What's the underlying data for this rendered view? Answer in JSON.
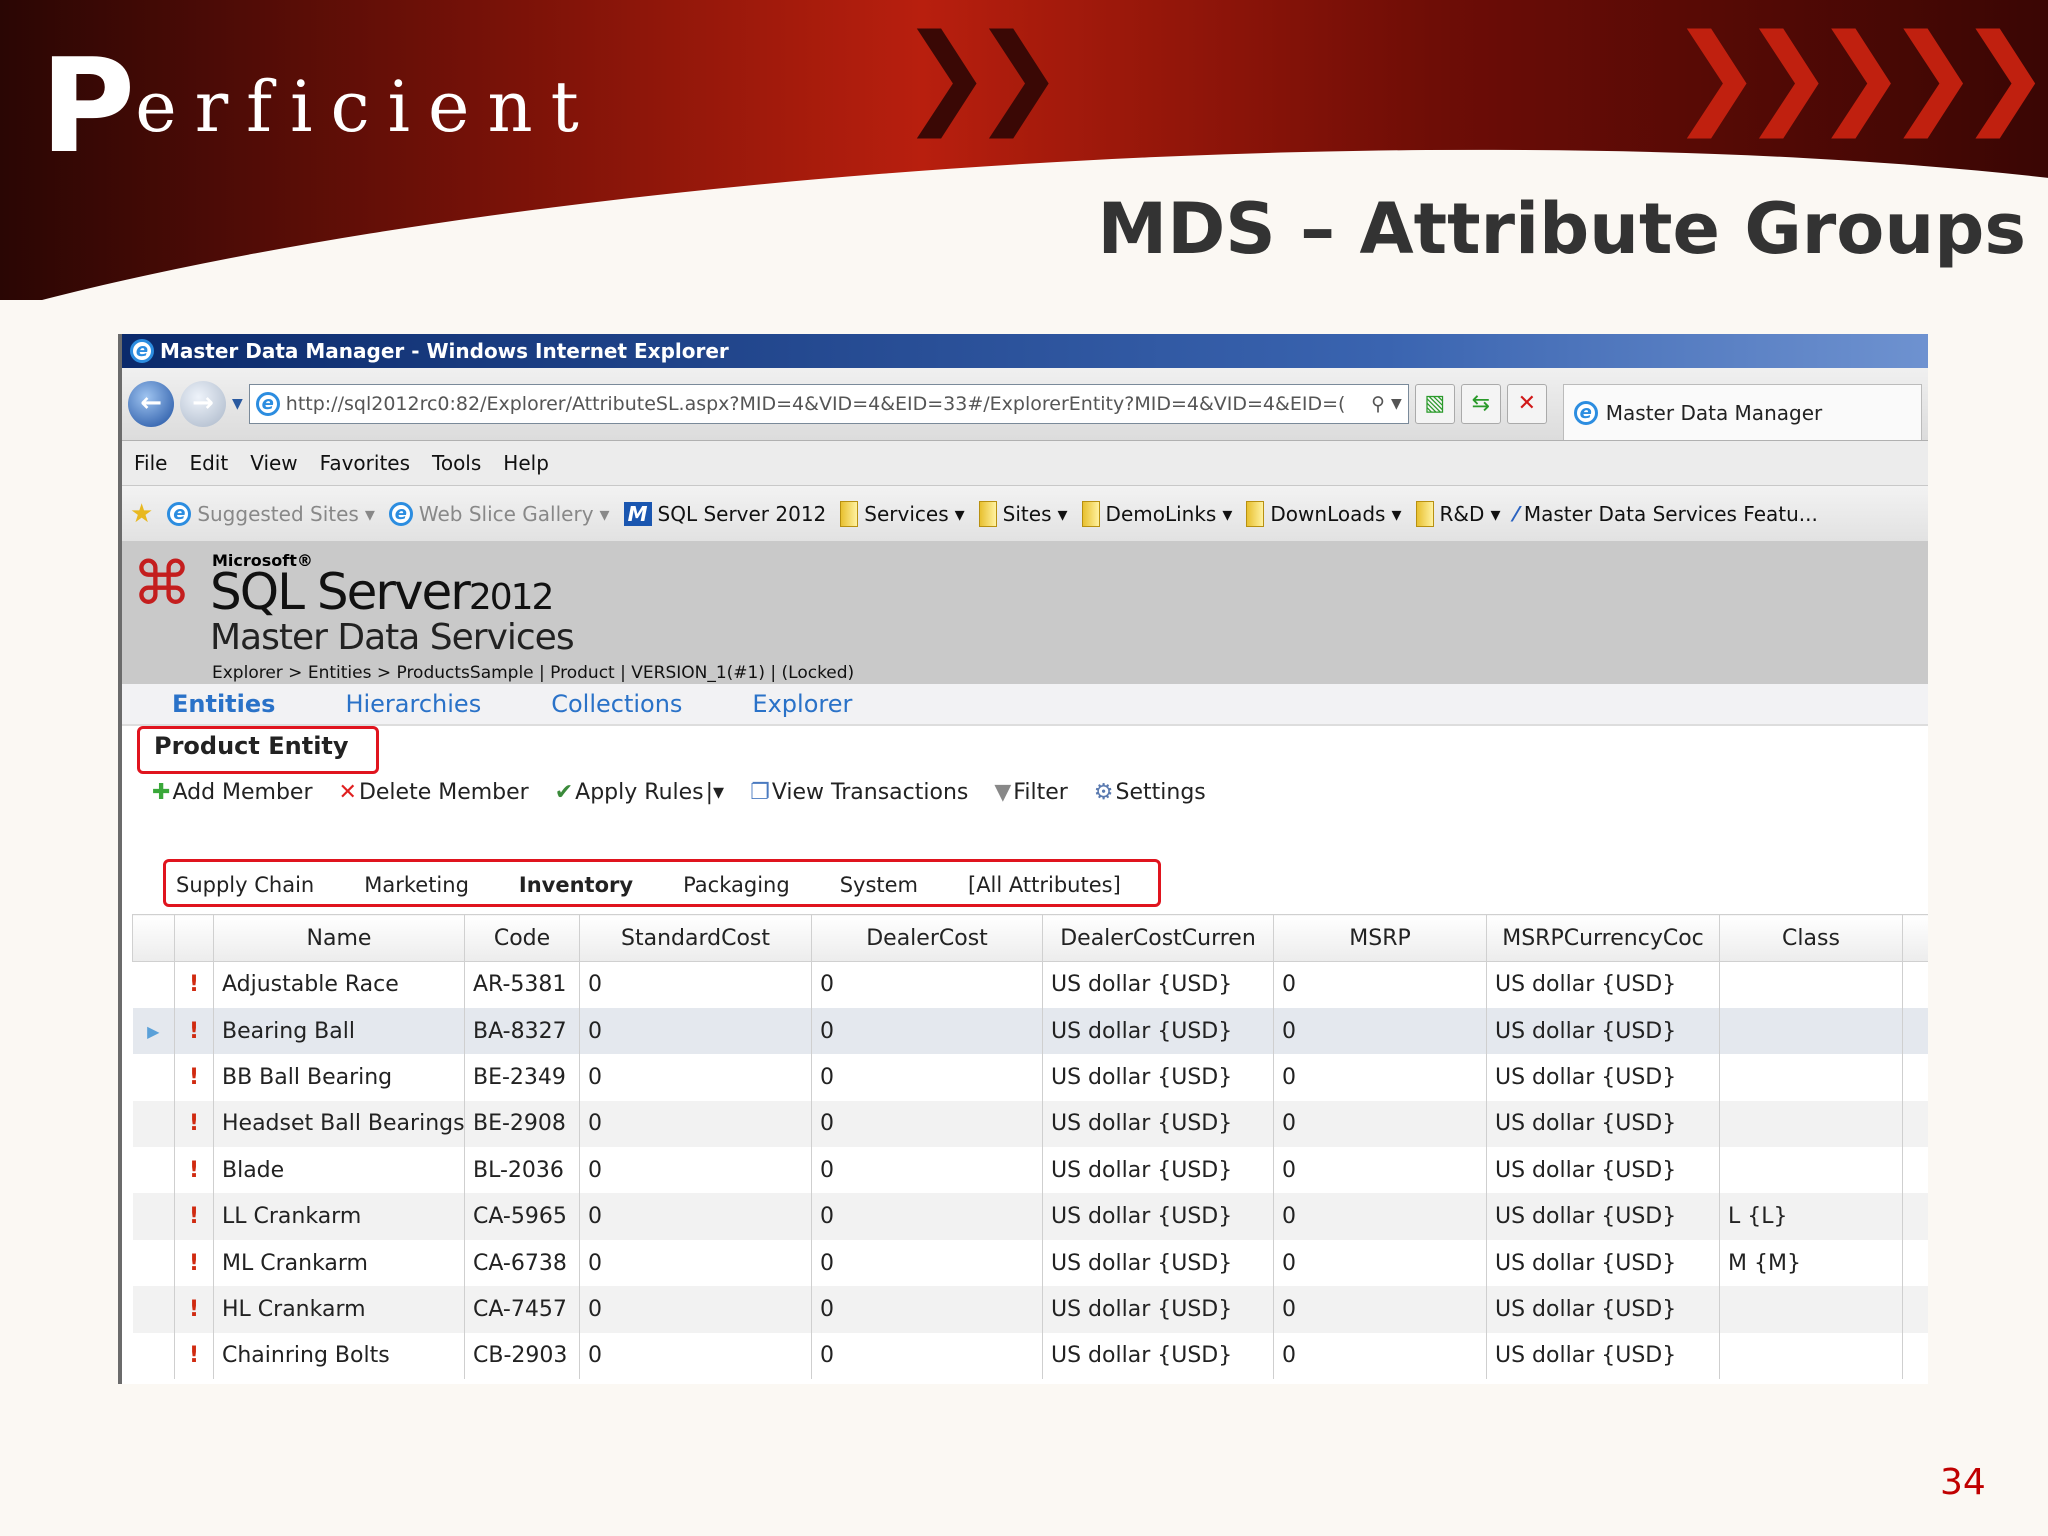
{
  "slide": {
    "logo": "Perficient",
    "title": "MDS – Attribute Groups",
    "page_number": "34"
  },
  "browser": {
    "window_title": "Master Data Manager - Windows Internet Explorer",
    "url": "http://sql2012rc0:82/Explorer/AttributeSL.aspx?MID=4&VID=4&EID=33#/ExplorerEntity?MID=4&VID=4&EID=(",
    "tab_title": "Master Data Manager",
    "menu": [
      "File",
      "Edit",
      "View",
      "Favorites",
      "Tools",
      "Help"
    ],
    "favorites": [
      {
        "label": "Suggested Sites",
        "dropdown": true,
        "icon": "ie-icon"
      },
      {
        "label": "Web Slice Gallery",
        "dropdown": true,
        "icon": "ie-icon"
      },
      {
        "label": "SQL Server 2012",
        "dropdown": false,
        "icon": "m-icon"
      },
      {
        "label": "Services",
        "dropdown": true,
        "icon": "folder-icon"
      },
      {
        "label": "Sites",
        "dropdown": true,
        "icon": "folder-icon"
      },
      {
        "label": "DemoLinks",
        "dropdown": true,
        "icon": "folder-icon"
      },
      {
        "label": "DownLoads",
        "dropdown": true,
        "icon": "folder-icon"
      },
      {
        "label": "R&D",
        "dropdown": true,
        "icon": "folder-icon"
      },
      {
        "label": "Master Data Services Featu...",
        "dropdown": false,
        "icon": "mds-icon"
      }
    ]
  },
  "mds": {
    "microsoft": "Microsoft®",
    "product": "SQL Server",
    "year": "2012",
    "subtitle": "Master Data Services",
    "breadcrumb": "Explorer > Entities > ProductsSample | Product | VERSION_1(#1) | (Locked)",
    "nav": [
      "Entities",
      "Hierarchies",
      "Collections",
      "Explorer"
    ],
    "entity_title": "Product Entity",
    "toolbar": [
      "Add Member",
      "Delete Member",
      "Apply Rules",
      "View Transactions",
      "Filter",
      "Settings"
    ],
    "attribute_groups": [
      "Supply Chain",
      "Marketing",
      "Inventory",
      "Packaging",
      "System",
      "[All Attributes]"
    ],
    "selected_group": "Inventory",
    "columns": [
      "Name",
      "Code",
      "StandardCost",
      "DealerCost",
      "DealerCostCurren",
      "MSRP",
      "MSRPCurrencyCoc",
      "Class"
    ],
    "rows": [
      [
        "Adjustable Race",
        "AR-5381",
        "0",
        "0",
        "US dollar {USD}",
        "0",
        "US dollar {USD}",
        ""
      ],
      [
        "Bearing Ball",
        "BA-8327",
        "0",
        "0",
        "US dollar {USD}",
        "0",
        "US dollar {USD}",
        ""
      ],
      [
        "BB Ball Bearing",
        "BE-2349",
        "0",
        "0",
        "US dollar {USD}",
        "0",
        "US dollar {USD}",
        ""
      ],
      [
        "Headset Ball Bearings",
        "BE-2908",
        "0",
        "0",
        "US dollar {USD}",
        "0",
        "US dollar {USD}",
        ""
      ],
      [
        "Blade",
        "BL-2036",
        "0",
        "0",
        "US dollar {USD}",
        "0",
        "US dollar {USD}",
        ""
      ],
      [
        "LL Crankarm",
        "CA-5965",
        "0",
        "0",
        "US dollar {USD}",
        "0",
        "US dollar {USD}",
        "L {L}"
      ],
      [
        "ML Crankarm",
        "CA-6738",
        "0",
        "0",
        "US dollar {USD}",
        "0",
        "US dollar {USD}",
        "M {M}"
      ],
      [
        "HL Crankarm",
        "CA-7457",
        "0",
        "0",
        "US dollar {USD}",
        "0",
        "US dollar {USD}",
        ""
      ],
      [
        "Chainring Bolts",
        "CB-2903",
        "0",
        "0",
        "US dollar {USD}",
        "0",
        "US dollar {USD}",
        ""
      ]
    ],
    "selected_row": 1
  }
}
